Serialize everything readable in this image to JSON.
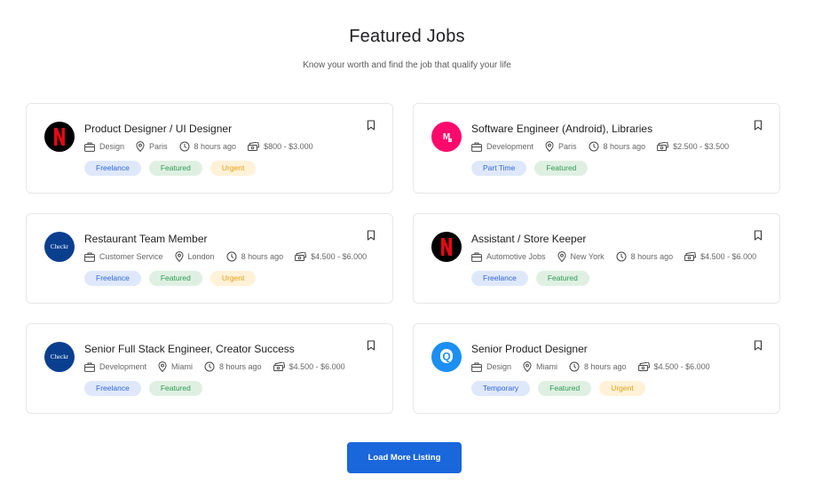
{
  "header": {
    "title": "Featured Jobs",
    "subtitle": "Know your worth and find the job that qualify your life"
  },
  "jobs": [
    {
      "logo": "netflix-logo",
      "title": "Product Designer / UI Designer",
      "category": "Design",
      "location": "Paris",
      "posted": "8 hours ago",
      "salary": "$800 - $3.000",
      "tags": [
        "Freelance",
        "Featured",
        "Urgent"
      ]
    },
    {
      "logo": "m-logo",
      "logo_text": "M",
      "title": "Software Engineer (Android), Libraries",
      "category": "Development",
      "location": "Paris",
      "posted": "8 hours ago",
      "salary": "$2.500 - $3.500",
      "tags": [
        "Part Time",
        "Featured"
      ]
    },
    {
      "logo": "checkr-logo",
      "logo_text": "Checkr",
      "title": "Restaurant Team Member",
      "category": "Customer Service",
      "location": "London",
      "posted": "8 hours ago",
      "salary": "$4.500 - $6.000",
      "tags": [
        "Freelance",
        "Featured",
        "Urgent"
      ]
    },
    {
      "logo": "netflix-logo",
      "title": "Assistant / Store Keeper",
      "category": "Automotive Jobs",
      "location": "New York",
      "posted": "8 hours ago",
      "salary": "$4.500 - $6.000",
      "tags": [
        "Freelance",
        "Featured"
      ]
    },
    {
      "logo": "checkr-logo",
      "logo_text": "Checkr",
      "title": "Senior Full Stack Engineer, Creator Success",
      "category": "Development",
      "location": "Miami",
      "posted": "8 hours ago",
      "salary": "$4.500 - $6.000",
      "tags": [
        "Freelance",
        "Featured"
      ]
    },
    {
      "logo": "q-logo",
      "logo_text": "Q",
      "title": "Senior Product Designer",
      "category": "Design",
      "location": "Miami",
      "posted": "8 hours ago",
      "salary": "$4.500 - $6.000",
      "tags": [
        "Temporary",
        "Featured",
        "Urgent"
      ]
    }
  ],
  "actions": {
    "load_more_label": "Load More Listing"
  },
  "colors": {
    "primary": "#1a66db",
    "tag_blue_bg": "#dfe8fb",
    "tag_green_bg": "#dff0e3",
    "tag_yellow_bg": "#fff2d8",
    "netflix": "#e50914",
    "m_brand": "#ff0a6c",
    "checkr_brand": "#0a3f8f",
    "q_brand": "#1c8ff2"
  },
  "icons": [
    "briefcase-icon",
    "map-pin-icon",
    "clock-icon",
    "money-icon",
    "bookmark-icon"
  ]
}
